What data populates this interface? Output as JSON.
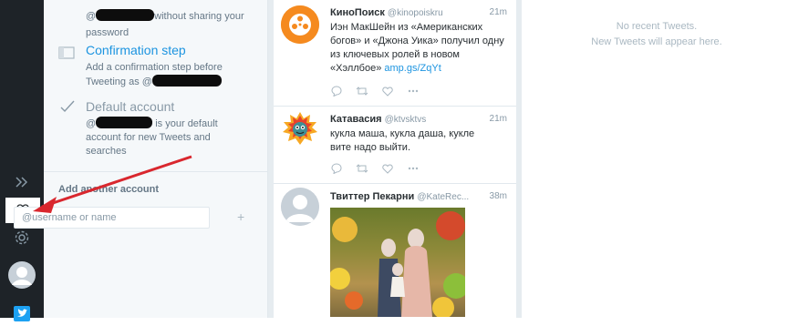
{
  "accounts_panel": {
    "share_desc_prefix": "@",
    "share_desc_suffix": "without sharing your password",
    "confirmation": {
      "title": "Confirmation step",
      "desc_prefix": "Add a confirmation step before Tweeting as @"
    },
    "default_account": {
      "title": "Default account",
      "desc_prefix": "@",
      "desc_suffix": "is your default account for new Tweets and searches"
    },
    "add_account": {
      "label": "Add another account",
      "placeholder": "@username or name",
      "plus": "+"
    }
  },
  "nav": {
    "icons": [
      "expand-icon",
      "accounts-icon",
      "settings-icon",
      "avatar",
      "twitter-bird-icon"
    ],
    "active": "accounts-icon"
  },
  "tweets": [
    {
      "name": "КиноПоиск",
      "handle": "@kinopoiskru",
      "time": "21m",
      "text": "Иэн МакШейн из «Американских богов» и «Джона Уика» получил одну из ключевых ролей в новом «Хэллбое»",
      "link": "amp.gs/ZqYt"
    },
    {
      "name": "Катавасия",
      "handle": "@ktvsktvs",
      "time": "21m",
      "text": "кукла маша, кукла даша, кукле вите надо выйти."
    },
    {
      "name": "Твиттер Пекарни",
      "handle": "@KateRec...",
      "time": "38m"
    }
  ],
  "empty_column": {
    "line1": "No recent Tweets.",
    "line2": "New Tweets will appear here."
  },
  "colors": {
    "accent": "#1c94e0",
    "rail": "#1e2328",
    "arrow": "#d9272e"
  }
}
